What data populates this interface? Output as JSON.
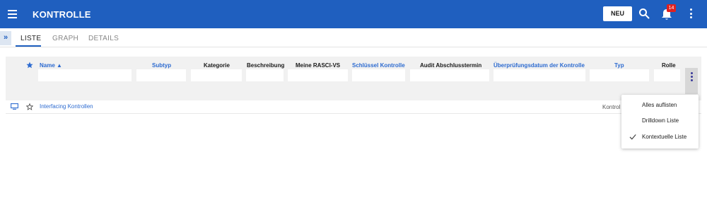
{
  "topbar": {
    "title": "KONTROLLE",
    "new_button": "NEU",
    "notification_count": "14",
    "background_color": "#1f5fbf",
    "icons": [
      "hamburger-icon",
      "search-icon",
      "bell-icon",
      "more-vert-icon"
    ]
  },
  "tabs": {
    "items": [
      {
        "label": "LISTE",
        "active": true
      },
      {
        "label": "GRAPH",
        "active": false
      },
      {
        "label": "DETAILS",
        "active": false
      }
    ]
  },
  "grid": {
    "columns": [
      {
        "label": "Name ▲",
        "link": true
      },
      {
        "label": "Subtyp",
        "link": true
      },
      {
        "label": "Kategorie",
        "link": false
      },
      {
        "label": "Beschreibung",
        "link": false
      },
      {
        "label": "Meine RASCI-VS",
        "link": false
      },
      {
        "label": "Schlüssel Kontrolle",
        "link": true
      },
      {
        "label": "Audit Abschlusstermin",
        "link": false
      },
      {
        "label": "Überprüfungsdatum der Kontrolle",
        "link": true
      },
      {
        "label": "Typ",
        "link": true
      },
      {
        "label": "Rolle",
        "link": false
      }
    ],
    "rows": [
      {
        "name": "Interfacing Kontrollen",
        "rolle": "Kontrol"
      }
    ]
  },
  "menu": {
    "items": [
      {
        "label": "Alles auflisten",
        "checked": false
      },
      {
        "label": "Drilldown Liste",
        "checked": false
      },
      {
        "label": "Kontextuelle Liste",
        "checked": true
      }
    ]
  }
}
